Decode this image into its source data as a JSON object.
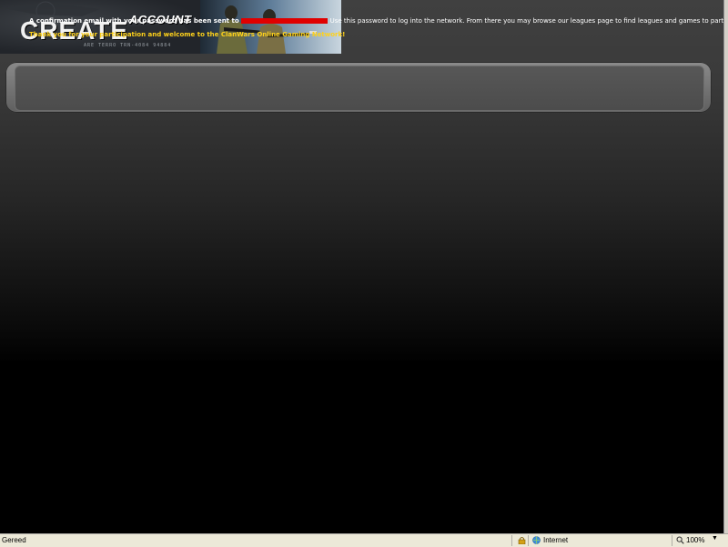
{
  "banner": {
    "title_main": "CREATE",
    "title_sub": "ACCOUNT",
    "small_text": "ARE TERRO  TRN-4084 94884"
  },
  "message": {
    "line1_prefix": "A confirmation email with your password has been sent to",
    "line1_suffix": "Use this password to log into the network. From there you may browse our leagues page to find leagues and games to participate in.",
    "line2": "Thank you for your participation and welcome to the ClanWars Online Gaming Network!"
  },
  "statusbar": {
    "status": "Gereed",
    "zone": "Internet",
    "zoom": "100%"
  },
  "colors": {
    "highlight": "#ffd21a",
    "redaction": "#e00000"
  }
}
